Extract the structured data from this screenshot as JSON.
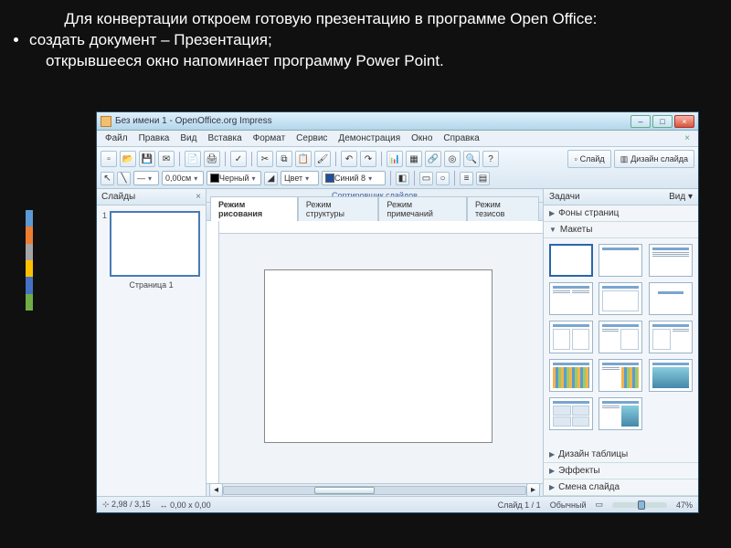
{
  "slide_text": {
    "para1": "Для конвертации откроем готовую презентацию в программе Open Office:",
    "bullet1": "создать документ – Презентация;",
    "para2": "открывшееся окно напоминает программу Power Point."
  },
  "app": {
    "title": "Без имени 1 - OpenOffice.org Impress",
    "menu": [
      "Файл",
      "Правка",
      "Вид",
      "Вставка",
      "Формат",
      "Сервис",
      "Демонстрация",
      "Окно",
      "Справка"
    ],
    "toolbar1": {
      "size_field": "0,00см",
      "color1_label": "Черный",
      "color2_prefix": "Цвет",
      "color2_label": "Синий 8"
    },
    "slide_btn": "Слайд",
    "design_btn": "Дизайн слайда",
    "slides_panel": {
      "title": "Слайды",
      "page_label": "Страница 1",
      "num": "1"
    },
    "center": {
      "sorter": "Сортировщик слайдов",
      "tabs": [
        "Режим рисования",
        "Режим структуры",
        "Режим примечаний",
        "Режим тезисов"
      ]
    },
    "tasks": {
      "title": "Задачи",
      "view": "Вид ▾",
      "sections": {
        "masters": "Фоны страниц",
        "layouts": "Макеты",
        "table": "Дизайн таблицы",
        "effects": "Эффекты",
        "transition": "Смена слайда"
      }
    },
    "status": {
      "pos": "2,98 / 3,15",
      "size": "0,00 x 0,00",
      "slide": "Слайд 1 / 1",
      "mode": "Обычный",
      "zoom": "47%"
    }
  }
}
